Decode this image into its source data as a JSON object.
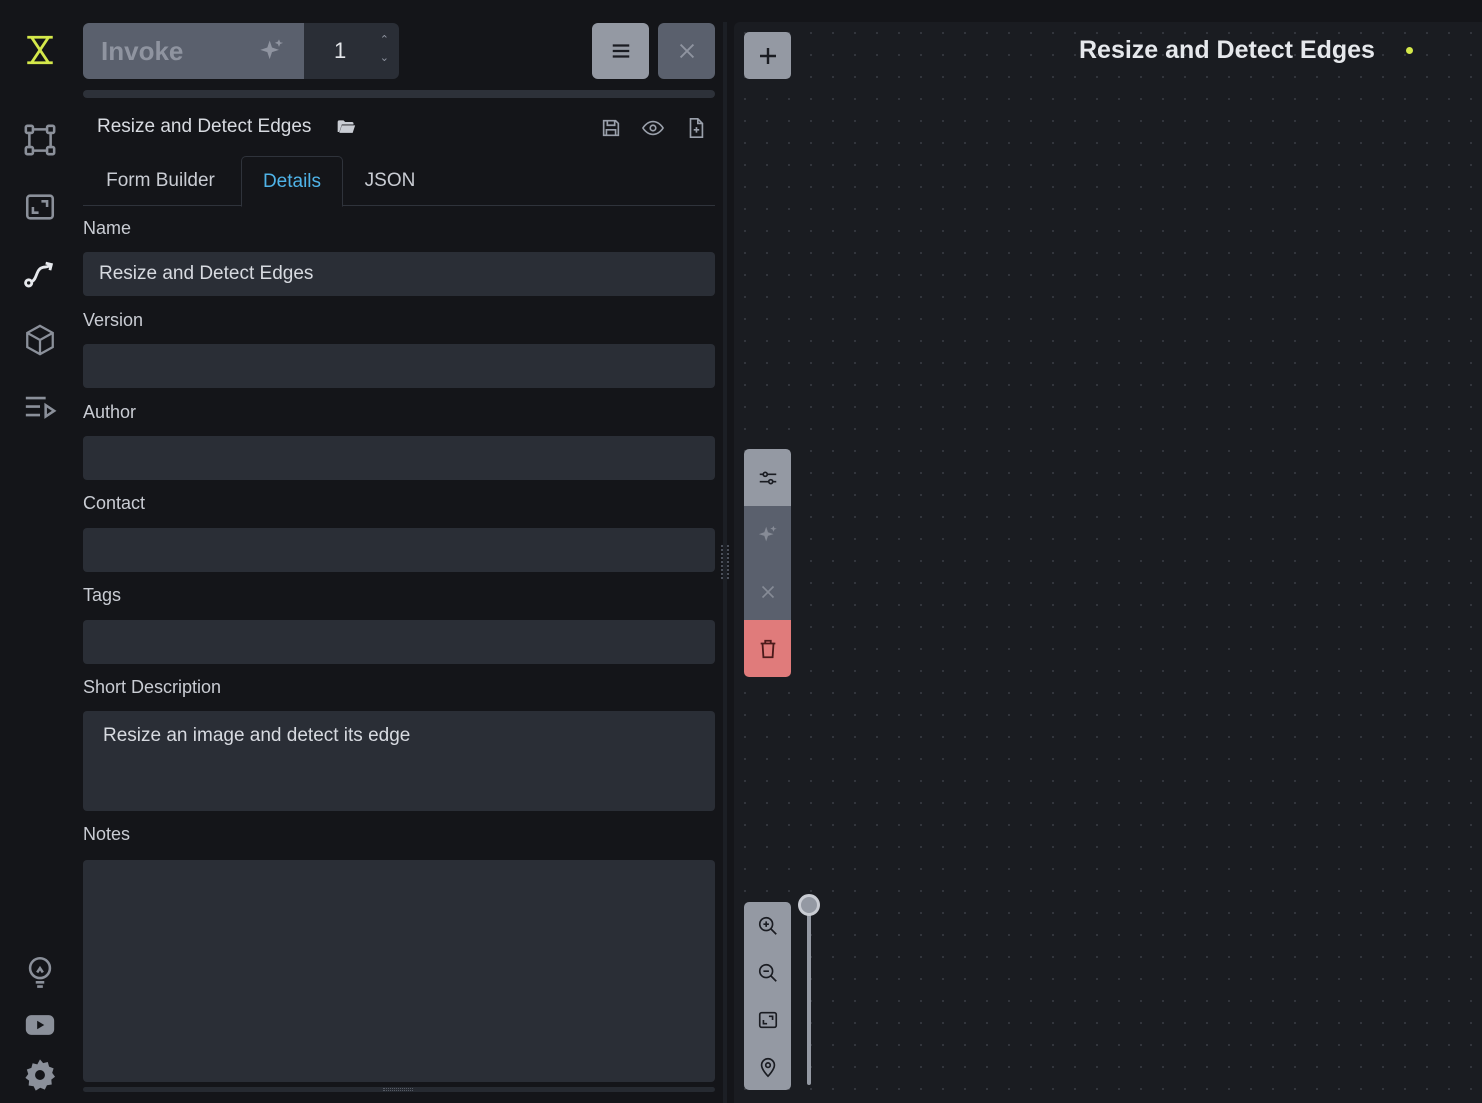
{
  "sidebar": {
    "items": [
      {
        "icon": "invoke-logo-icon"
      },
      {
        "icon": "nodes-icon"
      },
      {
        "icon": "canvas-icon"
      },
      {
        "icon": "workflows-icon"
      },
      {
        "icon": "models-icon"
      },
      {
        "icon": "queue-icon"
      }
    ],
    "bottom": [
      {
        "icon": "lightbulb-icon"
      },
      {
        "icon": "youtube-icon"
      },
      {
        "icon": "gear-icon"
      }
    ]
  },
  "toolbar": {
    "invoke_label": "Invoke",
    "count": "1"
  },
  "workflow": {
    "title": "Resize and Detect Edges"
  },
  "tabs": [
    {
      "label": "Form Builder"
    },
    {
      "label": "Details"
    },
    {
      "label": "JSON"
    }
  ],
  "active_tab": "Details",
  "details": {
    "name_label": "Name",
    "name_value": "Resize and Detect Edges",
    "version_label": "Version",
    "version_value": "",
    "author_label": "Author",
    "author_value": "",
    "contact_label": "Contact",
    "contact_value": "",
    "tags_label": "Tags",
    "tags_value": "",
    "short_desc_label": "Short Description",
    "short_desc_value": "Resize an image and detect its edge",
    "notes_label": "Notes",
    "notes_value": ""
  },
  "canvas": {
    "title": "Resize and Detect Edges",
    "zoom_level": 1.0
  },
  "colors": {
    "accent": "#4fb3e8",
    "logo": "#d4e84a",
    "danger": "#e07b7b",
    "background": "#141519"
  }
}
